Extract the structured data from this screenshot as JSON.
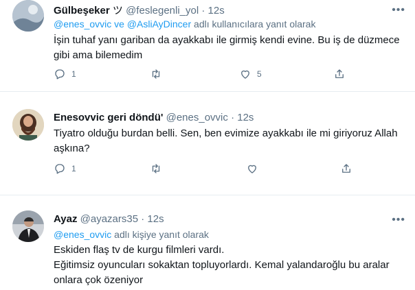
{
  "tweets": [
    {
      "name": "Gülbeşeker",
      "emoji": "ツ",
      "handle": "@feslegenli_yol",
      "dot": "·",
      "time": "12s",
      "reply_mention": "@enes_ovvic ve @AsliAyDincer",
      "reply_suffix": "adlı kullanıcılara yanıt olarak",
      "text": "İşin tuhaf yanı gariban da ayakkabı ile girmiş kendi evine. Bu iş de düzmece gibi ama bilemedim",
      "replies": "1",
      "retweets": "",
      "likes": "5",
      "more": "•••"
    },
    {
      "name": "Enesovvic geri döndü'",
      "handle": "@enes_ovvic",
      "dot": "·",
      "time": "12s",
      "text": "Tiyatro olduğu burdan belli. Sen, ben evimize ayakkabı ile mi giriyoruz Allah aşkına?",
      "replies": "1",
      "retweets": "",
      "likes": "",
      "more": "•••"
    },
    {
      "name": "Ayaz",
      "handle": "@ayazars35",
      "dot": "·",
      "time": "12s",
      "reply_mention": "@enes_ovvic",
      "reply_suffix": "adlı kişiye yanıt olarak",
      "text_lines": [
        "Eskiden flaş tv de kurgu filmleri vardı.",
        "Eğitimsiz oyuncuları sokaktan topluyorlardı. Kemal yalandaroğlu bu aralar onlara çok özeniyor"
      ],
      "more": "•••"
    }
  ],
  "icons": {
    "reply": "reply-icon",
    "retweet": "retweet-icon",
    "like": "like-icon",
    "share": "share-icon",
    "more": "more-icon"
  },
  "colors": {
    "link": "#1d9bf0",
    "muted": "#5b7083",
    "divider": "#e6ecf0"
  }
}
